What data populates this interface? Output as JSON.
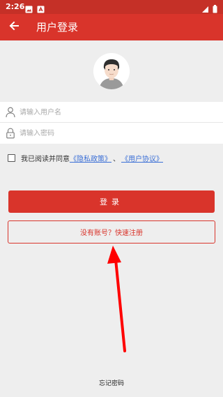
{
  "status_bar": {
    "time": "2:26",
    "left_icons": [
      "image-icon",
      "notification-icon"
    ],
    "right_icons": [
      "signal-icon",
      "battery-icon"
    ]
  },
  "app_bar": {
    "back_icon": "arrow-left-icon",
    "title": "用户登录"
  },
  "avatar": {
    "icon": "default-user-avatar"
  },
  "form": {
    "username": {
      "placeholder": "请输入用户名",
      "value": "",
      "icon": "user-icon"
    },
    "password": {
      "placeholder": "请输入密码",
      "value": "",
      "icon": "lock-icon"
    }
  },
  "agreement": {
    "checked": false,
    "prefix": "我已阅读并同意",
    "privacy_link": "《隐私政策》",
    "separator": "、",
    "terms_link": "《用户协议》"
  },
  "login_button": {
    "label": "登录"
  },
  "register_button": {
    "label": "没有账号？快速注册"
  },
  "forgot_password": {
    "label": "忘记密码"
  },
  "colors": {
    "brand_red": "#d9342b",
    "status_bar": "#c53027",
    "background": "#eeeeee",
    "link_blue": "#3b6fd6",
    "annotation_arrow": "#ff0000"
  }
}
